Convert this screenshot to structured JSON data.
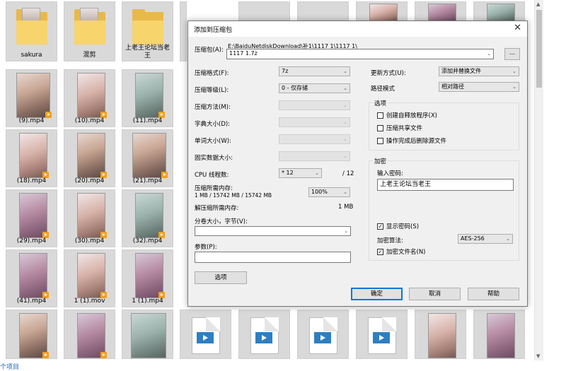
{
  "explorer": {
    "tiles": [
      {
        "label": "sakura"
      },
      {
        "label": "混剪"
      },
      {
        "label": "上老王论坛当老王"
      },
      {
        "label": ""
      },
      {
        "label": ""
      },
      {
        "label": ""
      },
      {
        "label": ""
      },
      {
        "label": ""
      },
      {
        "label": ""
      },
      {
        "label": "(9).mp4"
      },
      {
        "label": "(10).mp4"
      },
      {
        "label": "(11).mp4"
      },
      {
        "label": "(18).mp4"
      },
      {
        "label": "(20).mp4"
      },
      {
        "label": "(21).mp4"
      },
      {
        "label": "(29).mp4"
      },
      {
        "label": "(30).mp4"
      },
      {
        "label": "(32).mp4"
      },
      {
        "label": "(41).mp4"
      },
      {
        "label": "1 (1).mov"
      },
      {
        "label": "1 (1).mp4"
      }
    ],
    "status_text": "个项目"
  },
  "dialog": {
    "title": "添加到压缩包",
    "close_glyph": "✕",
    "archive_label": "压缩包(A):",
    "archive_path": "E:\\BaiduNetdiskDownload\\补1\\1117 1\\1117 1\\",
    "archive_name": "1117 1.7z",
    "browse_label": "...",
    "format_label": "压缩格式(F):",
    "format_value": "7z",
    "level_label": "压缩等级(L):",
    "level_value": "0 - 仅存储",
    "method_label": "压缩方法(M):",
    "dict_label": "字典大小(D):",
    "word_label": "单词大小(W):",
    "solid_label": "固实数据大小:",
    "cpu_label": "CPU 线程数:",
    "cpu_value": "* 12",
    "cpu_total": "/ 12",
    "mem_label": "压缩所需内存:",
    "mem_detail": "1 MB / 15742 MB / 15742 MB",
    "mem_percent": "100%",
    "decomp_label": "解压缩所需内存:",
    "decomp_value": "1 MB",
    "split_label": "分卷大小，字节(V):",
    "split_value": "",
    "params_label": "参数(P):",
    "params_value": "",
    "options_button": "选项",
    "update_label": "更新方式(U):",
    "update_value": "添加并替换文件",
    "path_label": "路径模式",
    "path_value": "相对路径",
    "options_group": "选项",
    "opt_sfx": "创建自释放程序(X)",
    "opt_shared": "压缩共享文件",
    "opt_delete": "操作完成后删除源文件",
    "encrypt_group": "加密",
    "password_label": "输入密码:",
    "password_value": "上老王论坛当老王",
    "show_password": "显示密码(S)",
    "enc_method_label": "加密算法:",
    "enc_method_value": "AES-256",
    "encrypt_names": "加密文件名(N)",
    "ok": "确定",
    "cancel": "取消",
    "help": "帮助",
    "arrow": "⌄",
    "check": "✓"
  }
}
